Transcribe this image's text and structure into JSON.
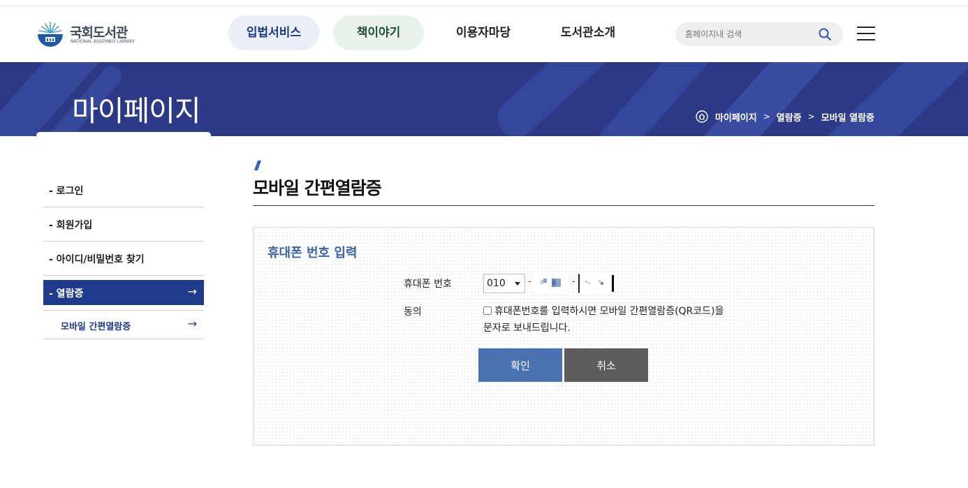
{
  "header": {
    "logo": {
      "name_ko": "국회도서관",
      "name_en": "NATIONAL ASSEMBLY LIBRARY"
    },
    "nav": [
      {
        "label": "입법서비스"
      },
      {
        "label": "책이야기"
      },
      {
        "label": "이용자마당"
      },
      {
        "label": "도서관소개"
      }
    ],
    "search": {
      "placeholder": "홈페이지내 검색"
    }
  },
  "visual": {
    "title": "마이페이지",
    "breadcrumb": [
      "마이페이지",
      "열람증",
      "모바일 열람증"
    ]
  },
  "sidebar": {
    "items": [
      {
        "label": "- 로그인"
      },
      {
        "label": "- 회원가입"
      },
      {
        "label": "- 아이디/비밀번호 찾기"
      },
      {
        "label": "- 열람증",
        "arrow": "→"
      }
    ],
    "sub": {
      "label": "모바일 간편열람증",
      "arrow": "→"
    }
  },
  "content": {
    "title": "모바일 간편열람증",
    "form": {
      "section_title": "휴대폰 번호 입력",
      "phone_label": "휴대폰 번호",
      "phone_prefix": "010",
      "dash": "-",
      "agree_label": "동의",
      "agree_text": "휴대폰번호를 입력하시면 모바일 간편열람증(QR코드)을 문자로 보내드립니다.",
      "confirm": "확인",
      "cancel": "취소"
    }
  },
  "colors": {
    "brand_navy": "#2c3a86",
    "active_nav": "#1f3a8a",
    "confirm_button": "#4a71b0",
    "cancel_button": "#5c5c5c"
  }
}
